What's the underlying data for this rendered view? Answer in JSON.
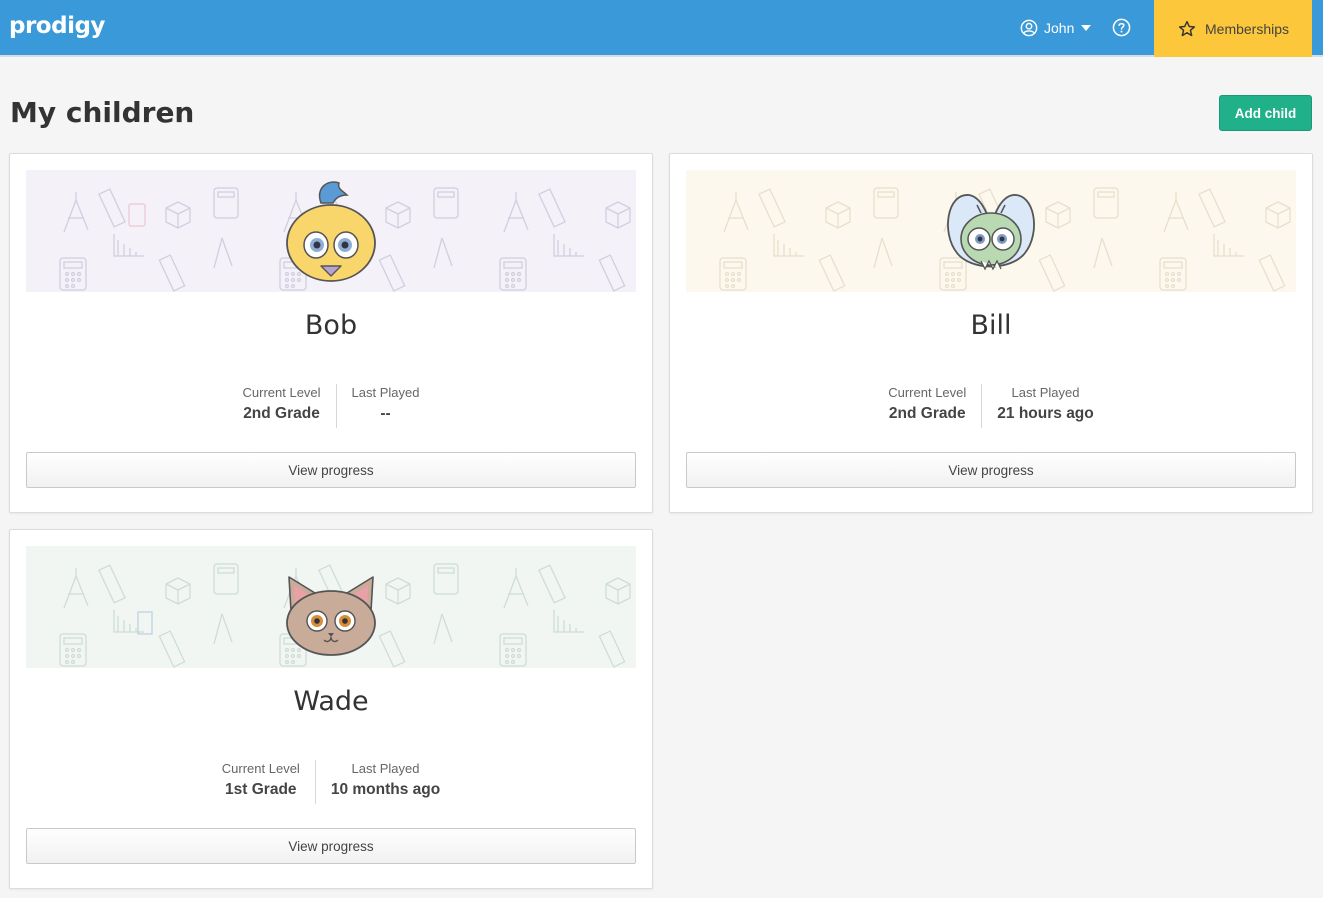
{
  "header": {
    "logo": "prodigy",
    "user_name": "John",
    "memberships_label": "Memberships",
    "bg_color": "#3a99d8",
    "memberships_color": "#fcc73a"
  },
  "page": {
    "title": "My children",
    "add_child_label": "Add child"
  },
  "children": [
    {
      "name": "Bob",
      "avatar": "bird-avatar",
      "current_level_label": "Current Level",
      "current_level": "2nd Grade",
      "last_played_label": "Last Played",
      "last_played": "--",
      "view_label": "View progress",
      "banner_color": "#f4f1f8"
    },
    {
      "name": "Bill",
      "avatar": "bug-avatar",
      "current_level_label": "Current Level",
      "current_level": "2nd Grade",
      "last_played_label": "Last Played",
      "last_played": "21 hours ago",
      "view_label": "View progress",
      "banner_color": "#fcf8ee"
    },
    {
      "name": "Wade",
      "avatar": "cat-avatar",
      "current_level_label": "Current Level",
      "current_level": "1st Grade",
      "last_played_label": "Last Played",
      "last_played": "10 months ago",
      "view_label": "View progress",
      "banner_color": "#f1f6f3"
    }
  ]
}
